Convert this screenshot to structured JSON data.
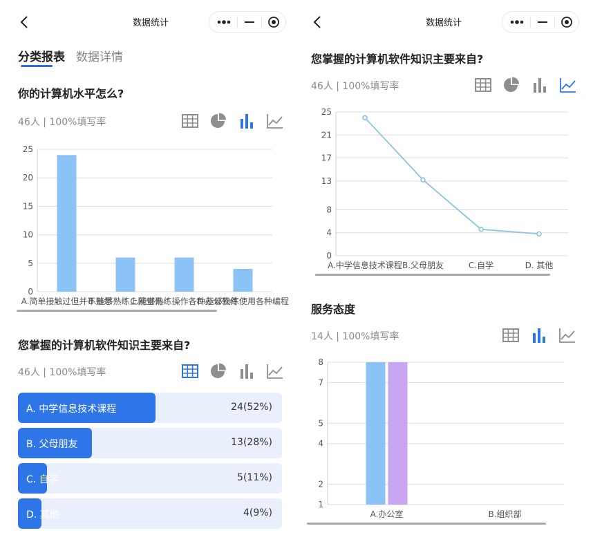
{
  "left": {
    "nav_title": "数据统计",
    "tabs": [
      "分类报表",
      "数据详情"
    ],
    "q1": {
      "title": "你的计算机水平怎么?",
      "meta": "46人 | 100%填写率",
      "chart_data": {
        "type": "bar",
        "categories": [
          "A.简单接触过但并不熟悉",
          "B.能够熟练上网查询",
          "C.能够熟练操作各种办公软件",
          "D.能够熟练使用各种编程"
        ],
        "values": [
          24,
          6,
          6,
          4
        ],
        "ylim": [
          0,
          25
        ],
        "yticks": [
          0,
          5,
          10,
          15,
          20,
          25
        ],
        "colors": [
          "#8cc3f7"
        ]
      }
    },
    "q2": {
      "title": "您掌握的计算机软件知识主要来自?",
      "meta": "46人 | 100%填写率",
      "rows": [
        {
          "label": "A. 中学信息技术课程",
          "value": "24(52%)",
          "pct": 52
        },
        {
          "label": "B. 父母朋友",
          "value": "13(28%)",
          "pct": 28
        },
        {
          "label": "C. 自学",
          "value": "5(11%)",
          "pct": 11
        },
        {
          "label": "D. 其他",
          "value": "4(9%)",
          "pct": 9
        }
      ]
    }
  },
  "right": {
    "nav_title": "数据统计",
    "q2": {
      "title": "您掌握的计算机软件知识主要来自?",
      "meta": "46人 | 100%填写率",
      "chart_data": {
        "type": "line",
        "categories": [
          "A.中学信息技术课程",
          "B.父母朋友",
          "C.自学",
          "D. 其他"
        ],
        "values": [
          24,
          13.2,
          4.6,
          3.8
        ],
        "ylim": [
          0,
          25
        ],
        "yticks": [
          0,
          4,
          8,
          13,
          17,
          21,
          25
        ],
        "colors": [
          "#8cc3de"
        ]
      }
    },
    "q3": {
      "title": "服务态度",
      "meta": "14人 | 100%填写率",
      "chart_data": {
        "type": "bar",
        "categories": [
          "A.办公室",
          "B.组织部"
        ],
        "series": [
          {
            "values": [
              8,
              0
            ],
            "color": "#8cc3f7"
          },
          {
            "values": [
              8,
              0
            ],
            "color": "#c9a6f2"
          }
        ],
        "ylim": [
          1,
          8
        ],
        "yticks": [
          1,
          2,
          4,
          5,
          7,
          8
        ]
      }
    }
  }
}
